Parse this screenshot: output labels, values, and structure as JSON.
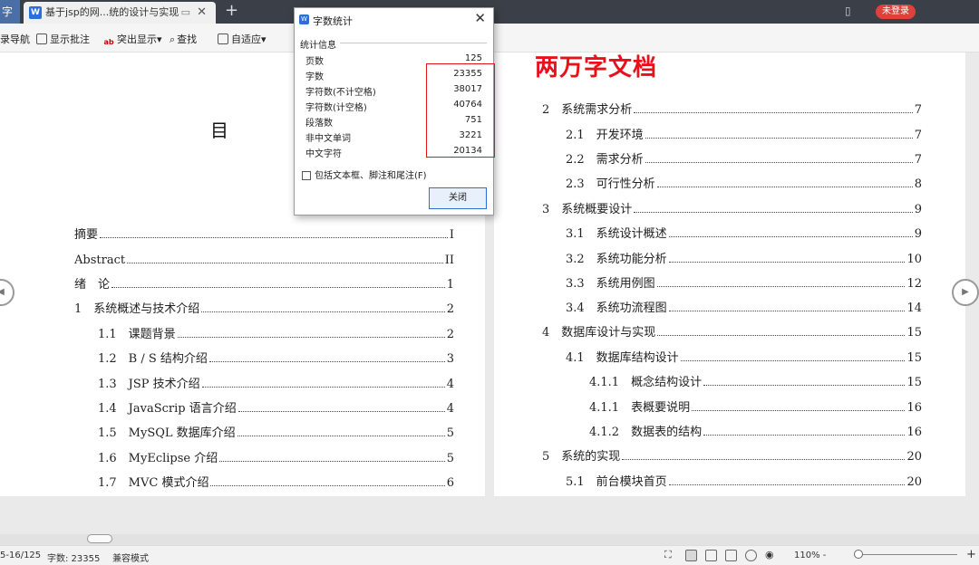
{
  "tabs": {
    "left_label": "字",
    "doc_icon": "W",
    "active_title": "基于jsp的网...统的设计与实现",
    "pin_icon": "▭",
    "close_icon": "✕",
    "new_tab_icon": "+",
    "login_badge": "未登录"
  },
  "toolbar": {
    "nav_label": "录导航",
    "show_comments": "显示批注",
    "highlight": "突出显示",
    "highlight_arrow": "▾",
    "find": "查找",
    "adapt": "自适应",
    "adapt_arrow": "▾"
  },
  "dialog": {
    "title": "字数统计",
    "group_label": "统计信息",
    "stats": [
      {
        "label": "页数",
        "value": "125"
      },
      {
        "label": "字数",
        "value": "23355"
      },
      {
        "label": "字符数(不计空格)",
        "value": "38017"
      },
      {
        "label": "字符数(计空格)",
        "value": "40764"
      },
      {
        "label": "段落数",
        "value": "751"
      },
      {
        "label": "非中文单词",
        "value": "3221"
      },
      {
        "label": "中文字符",
        "value": "20134"
      }
    ],
    "checkbox_label": "包括文本框、脚注和尾注(F)",
    "close_button": "关闭"
  },
  "left_page": {
    "toc_title": "目 录",
    "entries": [
      {
        "text": "摘要",
        "page": "I"
      },
      {
        "text": "Abstract",
        "page": "II"
      },
      {
        "text": "绪　论",
        "page": "1"
      },
      {
        "text": "1　系统概述与技术介绍",
        "page": "2"
      },
      {
        "text": "1.1　课题背景",
        "page": "2"
      },
      {
        "text": "1.2　B / S 结构介绍",
        "page": "3"
      },
      {
        "text": "1.3　JSP 技术介绍",
        "page": "4"
      },
      {
        "text": "1.4　JavaScrip 语言介绍",
        "page": "4"
      },
      {
        "text": "1.5　MySQL 数据库介绍",
        "page": "5"
      },
      {
        "text": "1.6　MyEclipse 介绍",
        "page": "5"
      },
      {
        "text": "1.7　MVC 模式介绍",
        "page": "6"
      }
    ]
  },
  "right_page": {
    "overlay_title": "两万字文档",
    "entries": [
      {
        "text": "2　系统需求分析",
        "page": "7"
      },
      {
        "text": "2.1　开发环境",
        "page": "7"
      },
      {
        "text": "2.2　需求分析",
        "page": "7"
      },
      {
        "text": "2.3　可行性分析",
        "page": "8"
      },
      {
        "text": "3　系统概要设计",
        "page": "9"
      },
      {
        "text": "3.1　系统设计概述",
        "page": "9"
      },
      {
        "text": "3.2　系统功能分析",
        "page": "10"
      },
      {
        "text": "3.3　系统用例图",
        "page": "12"
      },
      {
        "text": "3.4　系统功流程图",
        "page": "14"
      },
      {
        "text": "4　数据库设计与实现",
        "page": "15"
      },
      {
        "text": "4.1　数据库结构设计",
        "page": "15"
      },
      {
        "text": "4.1.1　概念结构设计",
        "page": "15"
      },
      {
        "text": "4.1.1　表概要说明",
        "page": "16"
      },
      {
        "text": "4.1.2　数据表的结构",
        "page": "16"
      },
      {
        "text": "5　系统的实现",
        "page": "20"
      },
      {
        "text": "5.1　前台模块首页",
        "page": "20"
      }
    ]
  },
  "statusbar": {
    "page_info": "5-16/125",
    "word_count": "字数: 23355",
    "mode": "兼容模式",
    "zoom": "110% -",
    "zoom_plus": "+"
  },
  "colors": {
    "accent_red": "#e8101a",
    "accent_blue": "#2c6fd6"
  }
}
